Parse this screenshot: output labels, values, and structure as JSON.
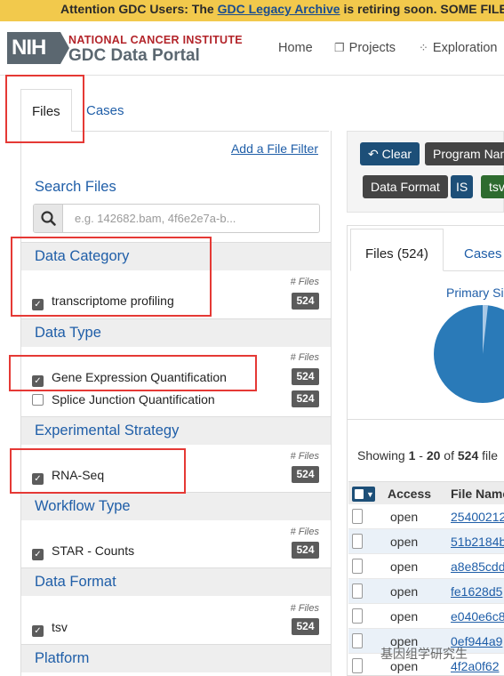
{
  "banner": {
    "prefix": "Attention GDC Users: The ",
    "link": "GDC Legacy Archive",
    "suffix": " is retiring soon. SOME FILE"
  },
  "header": {
    "logo": "NIH",
    "nci_title": "NATIONAL CANCER INSTITUTE",
    "portal_title": "GDC Data Portal",
    "nav": {
      "home": "Home",
      "projects": "Projects",
      "exploration": "Exploration"
    }
  },
  "left_tabs": {
    "files": "Files",
    "cases": "Cases"
  },
  "facets": {
    "add_filter": "Add a File Filter",
    "search_title": "Search Files",
    "search_placeholder": "e.g. 142682.bam, 4f6e2e7a-b...",
    "files_col_label": "# Files",
    "groups": [
      {
        "title": "Data Category",
        "terms": [
          {
            "label": "transcriptome profiling",
            "count": "524",
            "checked": true
          }
        ]
      },
      {
        "title": "Data Type",
        "terms": [
          {
            "label": "Gene Expression Quantification",
            "count": "524",
            "checked": true
          },
          {
            "label": "Splice Junction Quantification",
            "count": "524",
            "checked": false
          }
        ]
      },
      {
        "title": "Experimental Strategy",
        "terms": [
          {
            "label": "RNA-Seq",
            "count": "524",
            "checked": true
          }
        ]
      },
      {
        "title": "Workflow Type",
        "terms": [
          {
            "label": "STAR - Counts",
            "count": "524",
            "checked": true
          }
        ]
      },
      {
        "title": "Data Format",
        "terms": [
          {
            "label": "tsv",
            "count": "524",
            "checked": true
          }
        ]
      },
      {
        "title": "Platform",
        "terms": []
      }
    ]
  },
  "query": {
    "clear": "Clear",
    "program_name": "Program Nam",
    "data_format": "Data Format",
    "is": "IS",
    "tsv": "tsv"
  },
  "results": {
    "tab_files": "Files (524)",
    "tab_cases": "Cases",
    "chart_title": "Primary Si",
    "showing_prefix": "Showing ",
    "range_start": "1",
    "range_sep": " - ",
    "range_end": "20",
    "of": " of ",
    "total": "524",
    "suffix": " file",
    "columns": {
      "access": "Access",
      "file_name": "File Name"
    },
    "rows": [
      {
        "access": "open",
        "file": "25400212"
      },
      {
        "access": "open",
        "file": "51b2184b"
      },
      {
        "access": "open",
        "file": "a8e85cdd"
      },
      {
        "access": "open",
        "file": "fe1628d5"
      },
      {
        "access": "open",
        "file": "e040e6c8"
      },
      {
        "access": "open",
        "file": "0ef944a9"
      },
      {
        "access": "open",
        "file": "4f2a0f62"
      }
    ]
  },
  "watermark": "基因组学研究生",
  "colors": {
    "accent": "#1f5ea8",
    "highlight": "#e53935",
    "banner": "#f2c94c",
    "pie": "#2a7ab8"
  }
}
